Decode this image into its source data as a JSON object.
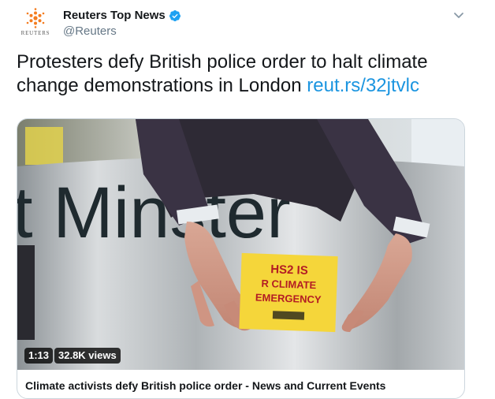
{
  "account": {
    "display_name": "Reuters Top News",
    "handle": "@Reuters",
    "avatar_wordmark": "REUTERS"
  },
  "tweet": {
    "text": "Protesters defy British police order to halt climate change demonstrations in London ",
    "link": "reut.rs/32jtvlc"
  },
  "media": {
    "duration": "1:13",
    "views": "32.8K views",
    "sign_text": [
      "HS2 IS",
      "R CLIMATE",
      "EMERGENCY"
    ],
    "signage_text": "t Minster"
  },
  "card": {
    "title": "Climate activists defy British police order - News and Current Events"
  },
  "colors": {
    "link": "#1b95e0",
    "verified": "#1da1f2",
    "sign": "#f5d63a",
    "reuters_orange": "#f47c20"
  },
  "icons": {
    "verified": "verified-badge-icon",
    "menu": "chevron-down-icon",
    "logo": "reuters-logo-icon"
  }
}
